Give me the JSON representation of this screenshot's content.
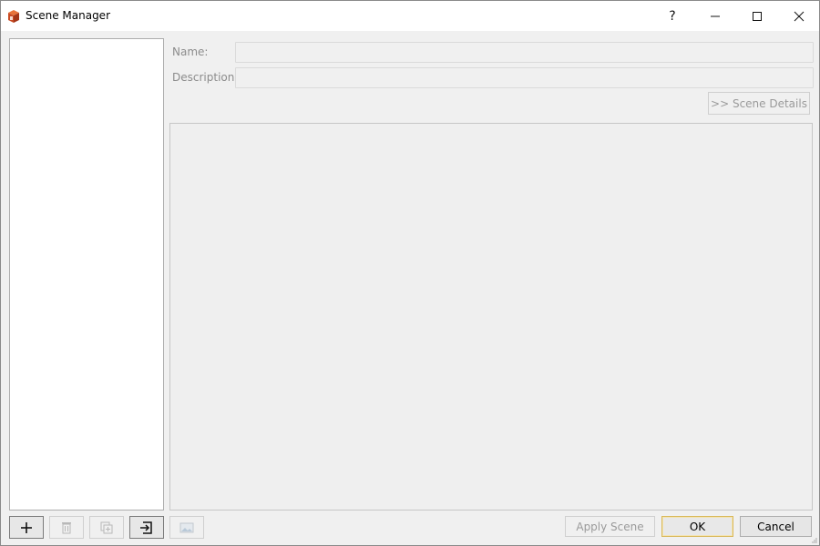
{
  "window": {
    "title": "Scene Manager",
    "help_label": "?"
  },
  "form": {
    "name_label": "Name:",
    "name_value": "",
    "description_label": "Description:",
    "description_value": "",
    "scene_details_label": ">> Scene Details"
  },
  "toolbar": {
    "icons": [
      "add-icon",
      "trash-icon",
      "duplicate-icon",
      "import-icon",
      "thumbnail-icon"
    ]
  },
  "actions": {
    "apply_label": "Apply Scene",
    "ok_label": "OK",
    "cancel_label": "Cancel"
  }
}
